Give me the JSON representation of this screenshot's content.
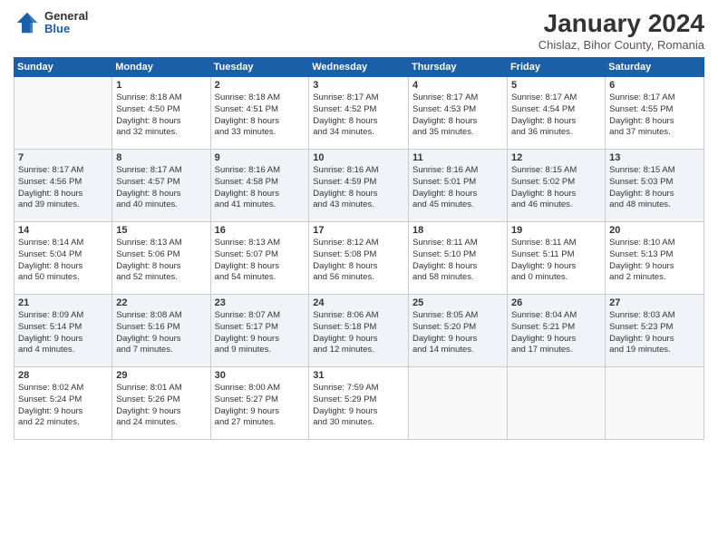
{
  "header": {
    "logo_general": "General",
    "logo_blue": "Blue",
    "month_title": "January 2024",
    "subtitle": "Chislaz, Bihor County, Romania"
  },
  "weekdays": [
    "Sunday",
    "Monday",
    "Tuesday",
    "Wednesday",
    "Thursday",
    "Friday",
    "Saturday"
  ],
  "weeks": [
    [
      {
        "day": "",
        "info": ""
      },
      {
        "day": "1",
        "info": "Sunrise: 8:18 AM\nSunset: 4:50 PM\nDaylight: 8 hours\nand 32 minutes."
      },
      {
        "day": "2",
        "info": "Sunrise: 8:18 AM\nSunset: 4:51 PM\nDaylight: 8 hours\nand 33 minutes."
      },
      {
        "day": "3",
        "info": "Sunrise: 8:17 AM\nSunset: 4:52 PM\nDaylight: 8 hours\nand 34 minutes."
      },
      {
        "day": "4",
        "info": "Sunrise: 8:17 AM\nSunset: 4:53 PM\nDaylight: 8 hours\nand 35 minutes."
      },
      {
        "day": "5",
        "info": "Sunrise: 8:17 AM\nSunset: 4:54 PM\nDaylight: 8 hours\nand 36 minutes."
      },
      {
        "day": "6",
        "info": "Sunrise: 8:17 AM\nSunset: 4:55 PM\nDaylight: 8 hours\nand 37 minutes."
      }
    ],
    [
      {
        "day": "7",
        "info": "Sunrise: 8:17 AM\nSunset: 4:56 PM\nDaylight: 8 hours\nand 39 minutes."
      },
      {
        "day": "8",
        "info": "Sunrise: 8:17 AM\nSunset: 4:57 PM\nDaylight: 8 hours\nand 40 minutes."
      },
      {
        "day": "9",
        "info": "Sunrise: 8:16 AM\nSunset: 4:58 PM\nDaylight: 8 hours\nand 41 minutes."
      },
      {
        "day": "10",
        "info": "Sunrise: 8:16 AM\nSunset: 4:59 PM\nDaylight: 8 hours\nand 43 minutes."
      },
      {
        "day": "11",
        "info": "Sunrise: 8:16 AM\nSunset: 5:01 PM\nDaylight: 8 hours\nand 45 minutes."
      },
      {
        "day": "12",
        "info": "Sunrise: 8:15 AM\nSunset: 5:02 PM\nDaylight: 8 hours\nand 46 minutes."
      },
      {
        "day": "13",
        "info": "Sunrise: 8:15 AM\nSunset: 5:03 PM\nDaylight: 8 hours\nand 48 minutes."
      }
    ],
    [
      {
        "day": "14",
        "info": "Sunrise: 8:14 AM\nSunset: 5:04 PM\nDaylight: 8 hours\nand 50 minutes."
      },
      {
        "day": "15",
        "info": "Sunrise: 8:13 AM\nSunset: 5:06 PM\nDaylight: 8 hours\nand 52 minutes."
      },
      {
        "day": "16",
        "info": "Sunrise: 8:13 AM\nSunset: 5:07 PM\nDaylight: 8 hours\nand 54 minutes."
      },
      {
        "day": "17",
        "info": "Sunrise: 8:12 AM\nSunset: 5:08 PM\nDaylight: 8 hours\nand 56 minutes."
      },
      {
        "day": "18",
        "info": "Sunrise: 8:11 AM\nSunset: 5:10 PM\nDaylight: 8 hours\nand 58 minutes."
      },
      {
        "day": "19",
        "info": "Sunrise: 8:11 AM\nSunset: 5:11 PM\nDaylight: 9 hours\nand 0 minutes."
      },
      {
        "day": "20",
        "info": "Sunrise: 8:10 AM\nSunset: 5:13 PM\nDaylight: 9 hours\nand 2 minutes."
      }
    ],
    [
      {
        "day": "21",
        "info": "Sunrise: 8:09 AM\nSunset: 5:14 PM\nDaylight: 9 hours\nand 4 minutes."
      },
      {
        "day": "22",
        "info": "Sunrise: 8:08 AM\nSunset: 5:16 PM\nDaylight: 9 hours\nand 7 minutes."
      },
      {
        "day": "23",
        "info": "Sunrise: 8:07 AM\nSunset: 5:17 PM\nDaylight: 9 hours\nand 9 minutes."
      },
      {
        "day": "24",
        "info": "Sunrise: 8:06 AM\nSunset: 5:18 PM\nDaylight: 9 hours\nand 12 minutes."
      },
      {
        "day": "25",
        "info": "Sunrise: 8:05 AM\nSunset: 5:20 PM\nDaylight: 9 hours\nand 14 minutes."
      },
      {
        "day": "26",
        "info": "Sunrise: 8:04 AM\nSunset: 5:21 PM\nDaylight: 9 hours\nand 17 minutes."
      },
      {
        "day": "27",
        "info": "Sunrise: 8:03 AM\nSunset: 5:23 PM\nDaylight: 9 hours\nand 19 minutes."
      }
    ],
    [
      {
        "day": "28",
        "info": "Sunrise: 8:02 AM\nSunset: 5:24 PM\nDaylight: 9 hours\nand 22 minutes."
      },
      {
        "day": "29",
        "info": "Sunrise: 8:01 AM\nSunset: 5:26 PM\nDaylight: 9 hours\nand 24 minutes."
      },
      {
        "day": "30",
        "info": "Sunrise: 8:00 AM\nSunset: 5:27 PM\nDaylight: 9 hours\nand 27 minutes."
      },
      {
        "day": "31",
        "info": "Sunrise: 7:59 AM\nSunset: 5:29 PM\nDaylight: 9 hours\nand 30 minutes."
      },
      {
        "day": "",
        "info": ""
      },
      {
        "day": "",
        "info": ""
      },
      {
        "day": "",
        "info": ""
      }
    ]
  ]
}
